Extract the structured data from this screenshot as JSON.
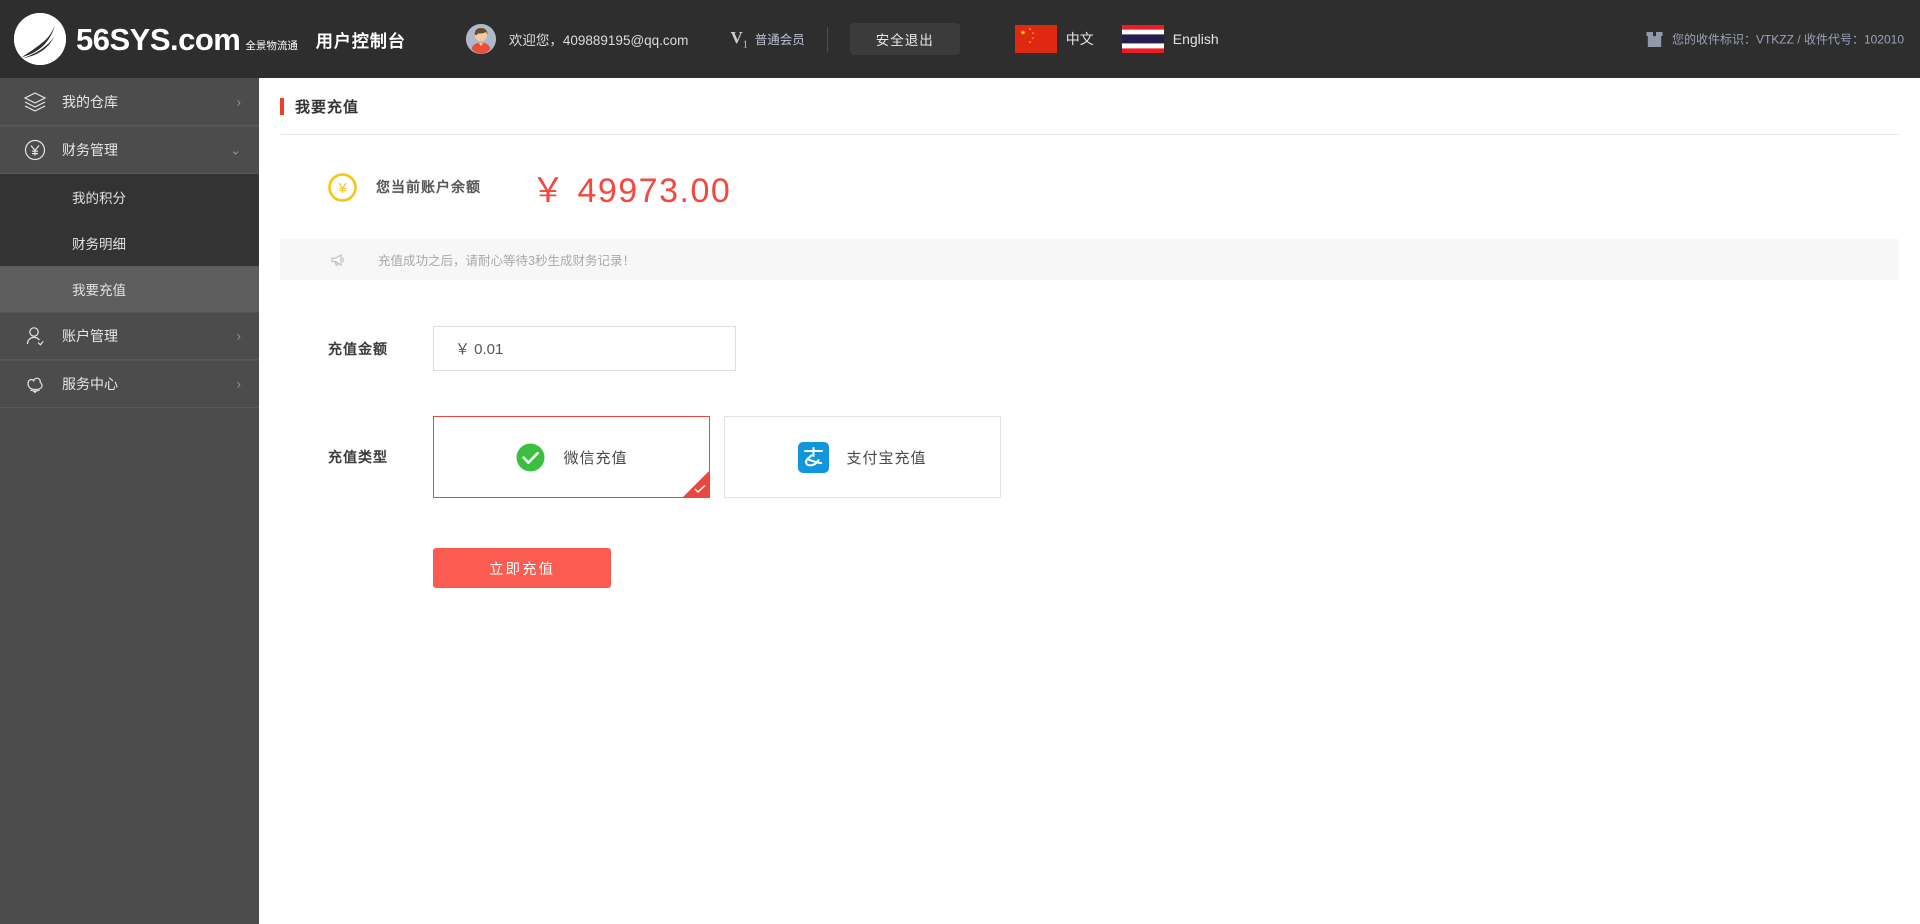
{
  "header": {
    "brand_name": "56SYS",
    "brand_domain": ".com",
    "brand_cn_line1": "全景物流通",
    "console_title": "用户控制台",
    "welcome_text": "欢迎您，409889195@qq.com",
    "vip_badge": "V",
    "vip_badge_sub": "1",
    "vip_label": "普通会员",
    "logout_label": "安全退出",
    "lang_cn": "中文",
    "lang_en": "English",
    "recv_info": "您的收件标识：VTKZZ / 收件代号：102010"
  },
  "sidebar": {
    "items": [
      {
        "label": "我的仓库",
        "icon": "layers-icon",
        "chevron": "›"
      },
      {
        "label": "财务管理",
        "icon": "yen-circle-icon",
        "chevron": "⌄"
      },
      {
        "label": "账户管理",
        "icon": "user-icon",
        "chevron": "›"
      },
      {
        "label": "服务中心",
        "icon": "flower-icon",
        "chevron": "›"
      }
    ],
    "sub_items": [
      {
        "label": "我的积分",
        "active": false
      },
      {
        "label": "财务明细",
        "active": false
      },
      {
        "label": "我要充值",
        "active": true
      }
    ]
  },
  "main": {
    "page_title": "我要充值",
    "balance_label": "您当前账户余额",
    "balance_amount": "￥ 49973.00",
    "notice_text": "充值成功之后，请耐心等待3秒生成财务记录！",
    "amount_label": "充值金额",
    "amount_value": "￥ 0.01",
    "amount_placeholder": "￥ 0.01",
    "paytype_label": "充值类型",
    "pay_options": [
      {
        "label": "微信充值",
        "icon": "wechat-icon",
        "selected": true
      },
      {
        "label": "支付宝充值",
        "icon": "alipay-icon",
        "selected": false
      }
    ],
    "submit_label": "立即充值"
  },
  "colors": {
    "accent_red": "#e8402a",
    "submit_red": "#fb5b50",
    "balance_red": "#f4473f",
    "header_bg": "#2e2e2e",
    "sidebar_bg": "#4c4c4c",
    "sidebar_sub_bg": "#333333",
    "sidebar_active_bg": "#5d5d5d",
    "wechat_green": "#3cbf3f",
    "alipay_blue": "#1296db"
  }
}
